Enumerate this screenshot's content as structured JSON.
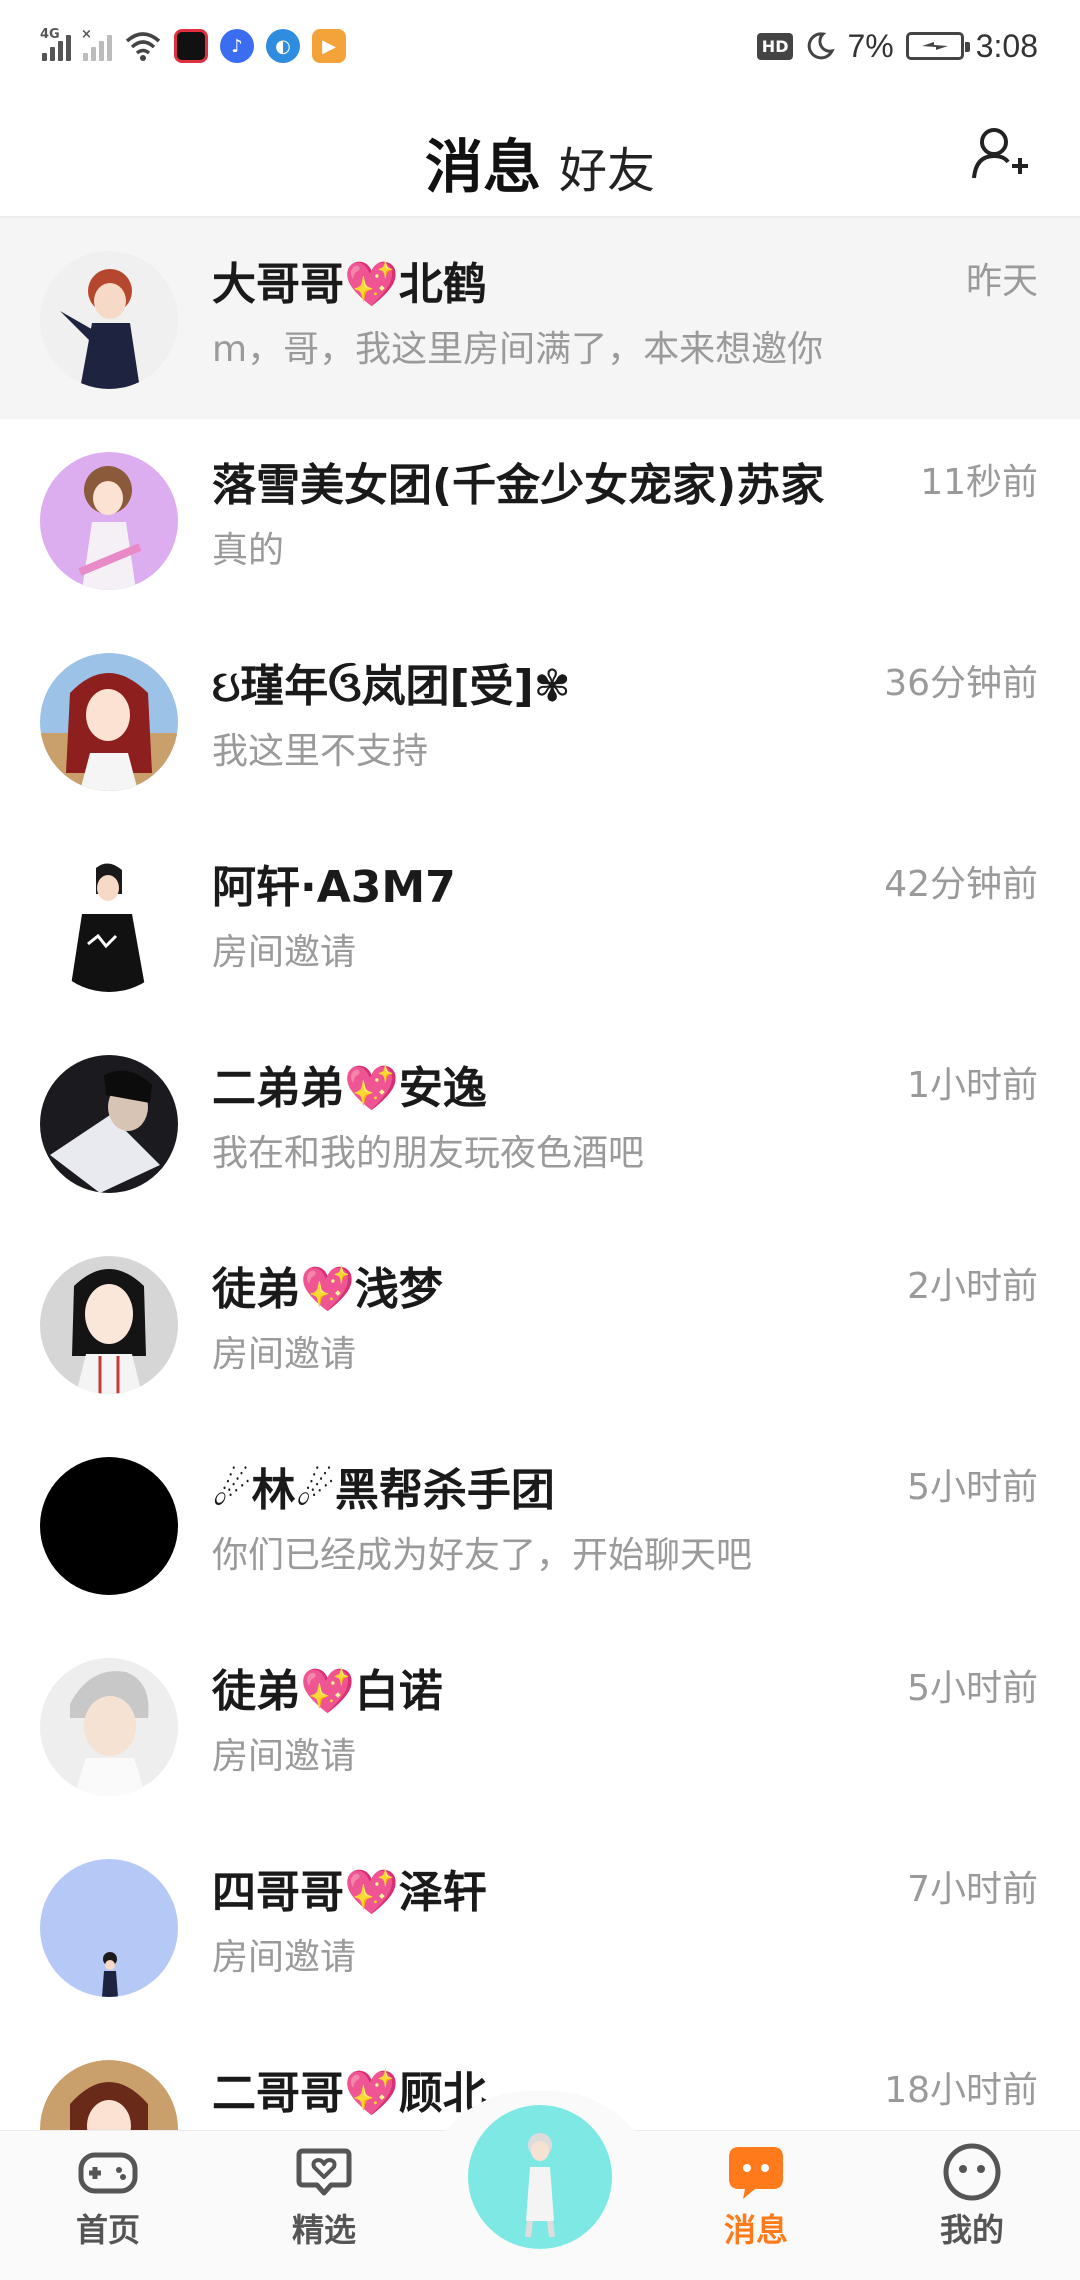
{
  "status_bar": {
    "network_1": "4G",
    "network_2": "×",
    "battery_percent": "7%",
    "time": "3:08",
    "hd_label": "HD"
  },
  "header": {
    "tabs": [
      {
        "label": "消息",
        "active": true
      },
      {
        "label": "好友",
        "active": false
      }
    ]
  },
  "conversations": [
    {
      "name": "大哥哥💖北鹤",
      "time": "昨天",
      "message": "m，哥，我这里房间满了，本来想邀你",
      "highlighted": true
    },
    {
      "name": "落雪美女团(千金少女宠家)苏家",
      "time": "11秒前",
      "message": "真的"
    },
    {
      "name": "ઇ瑾年ઉ岚团[受]✾",
      "time": "36分钟前",
      "message": "我这里不支持"
    },
    {
      "name": "阿轩·A3M7",
      "time": "42分钟前",
      "message": "房间邀请"
    },
    {
      "name": "二弟弟💖安逸",
      "time": "1小时前",
      "message": "我在和我的朋友玩夜色酒吧"
    },
    {
      "name": "徒弟💖浅梦",
      "time": "2小时前",
      "message": "房间邀请"
    },
    {
      "name": "☄林☄黑帮杀手团",
      "time": "5小时前",
      "message": "你们已经成为好友了，开始聊天吧"
    },
    {
      "name": "徒弟💖白诺",
      "time": "5小时前",
      "message": "房间邀请"
    },
    {
      "name": "四哥哥💖泽轩",
      "time": "7小时前",
      "message": "房间邀请"
    },
    {
      "name": "二哥哥💖顾北",
      "time": "18小时前",
      "message": ""
    }
  ],
  "bottom_nav": [
    {
      "label": "首页",
      "icon": "gamepad-icon"
    },
    {
      "label": "精选",
      "icon": "heart-chat-icon"
    },
    {
      "label": "消息",
      "icon": "message-icon",
      "active": true
    },
    {
      "label": "我的",
      "icon": "smiley-icon"
    }
  ],
  "colors": {
    "accent": "#ff7a1a",
    "muted": "#9a9a9a"
  }
}
